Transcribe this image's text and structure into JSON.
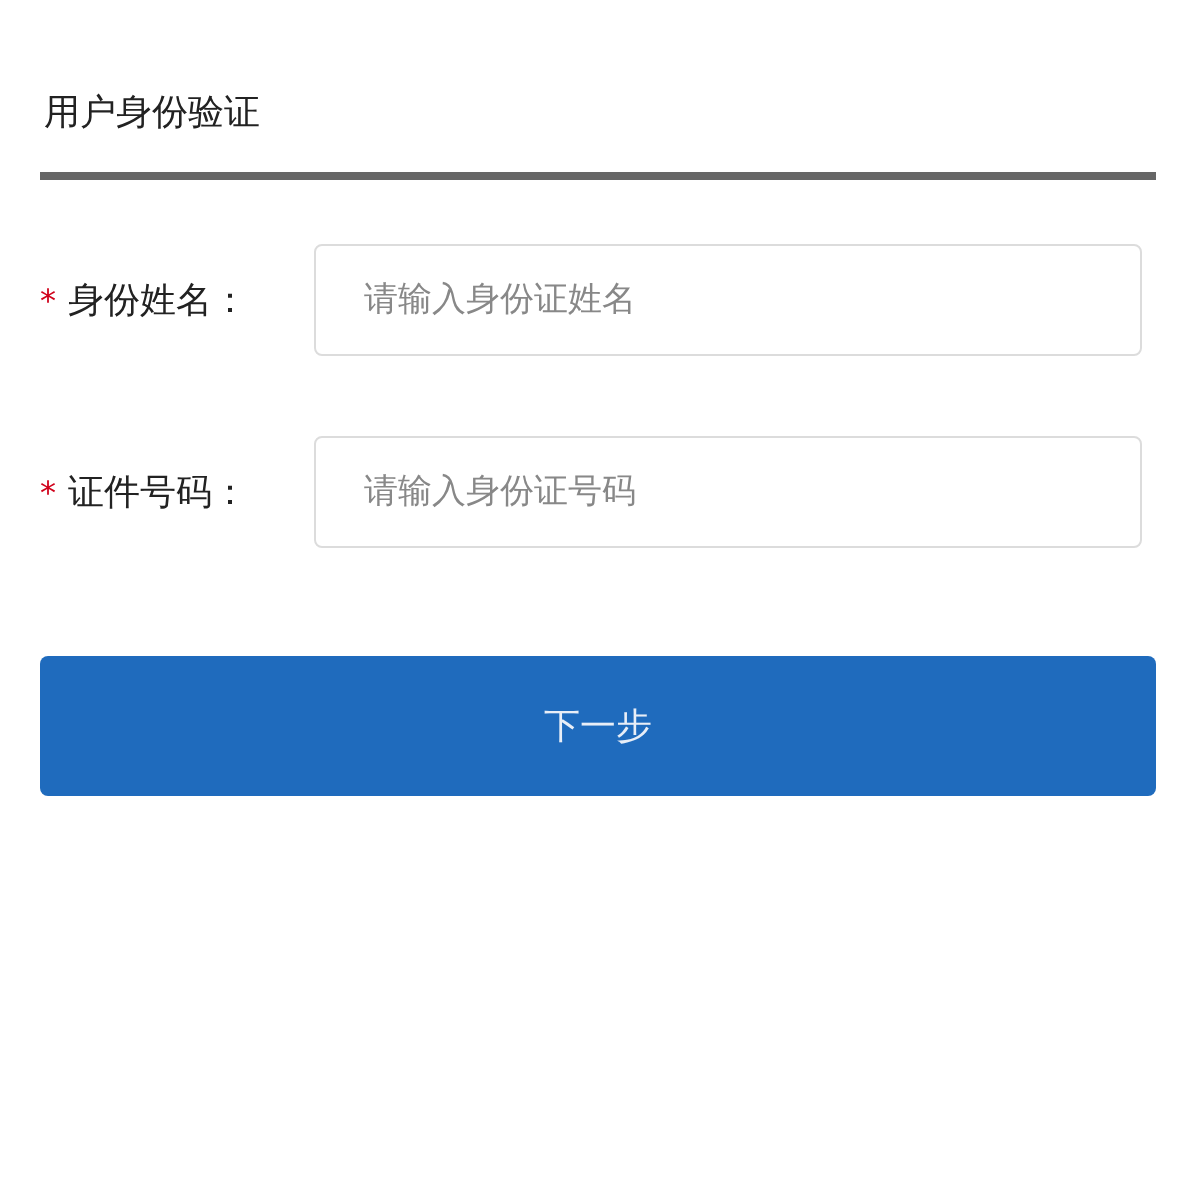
{
  "title": "用户身份验证",
  "fields": [
    {
      "marker": "*",
      "label": "身份姓名：",
      "placeholder": "请输入身份证姓名"
    },
    {
      "marker": "*",
      "label": "证件号码：",
      "placeholder": "请输入身份证号码"
    }
  ],
  "button": "下一步"
}
